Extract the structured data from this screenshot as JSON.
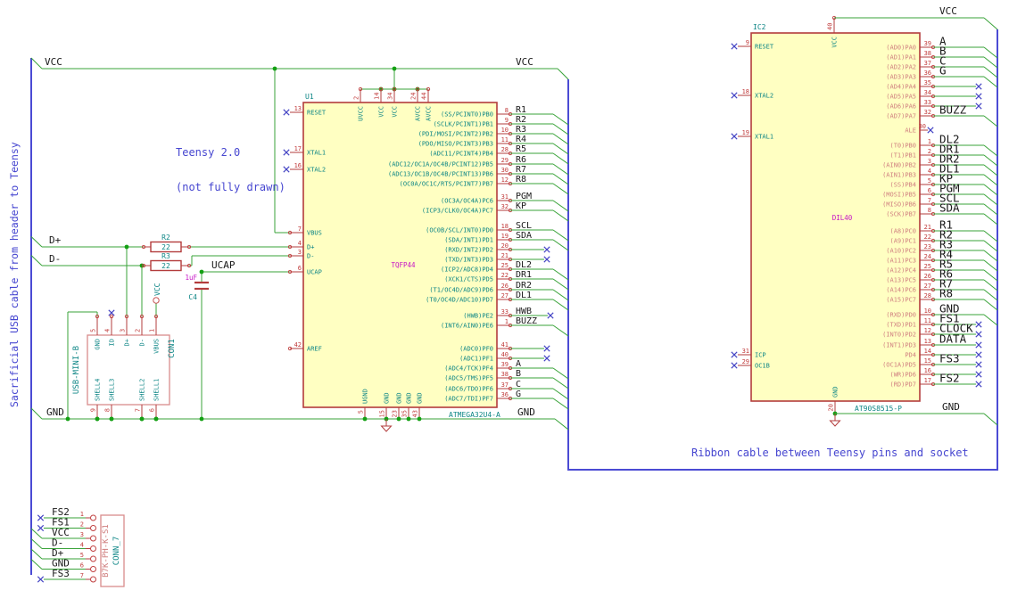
{
  "annotations": {
    "left_cable_note": "Sacrificial USB cable from header to Teensy",
    "teensy_note_line1": "Teensy 2.0",
    "teensy_note_line2": "(not fully drawn)",
    "ribbon_note": "Ribbon cable between Teensy pins and socket"
  },
  "power_labels": {
    "vcc_top_left": "VCC",
    "vcc_top_right": "VCC",
    "dplus": "D+",
    "dminus": "D-",
    "ucap": "UCAP",
    "gnd_left": "GND",
    "gnd_mid": "GND",
    "ic2_vcc": "VCC",
    "ic2_gnd": "GND",
    "usb_vcc": "VCC"
  },
  "u1": {
    "ref": "U1",
    "value": "ATMEGA32U4-A",
    "footprint": "TQFP44",
    "left_pins": [
      {
        "num": "13",
        "name": "RESET",
        "nc": true
      },
      {
        "num": "17",
        "name": "XTAL1",
        "nc": true
      },
      {
        "num": "16",
        "name": "XTAL2",
        "nc": true
      },
      {
        "num": "7",
        "name": "VBUS"
      },
      {
        "num": "4",
        "name": "D+"
      },
      {
        "num": "3",
        "name": "D-"
      },
      {
        "num": "6",
        "name": "UCAP"
      },
      {
        "num": "42",
        "name": "AREF"
      }
    ],
    "top_pins": [
      {
        "num": "2",
        "name": "UVCC"
      },
      {
        "num": "14",
        "name": "VCC"
      },
      {
        "num": "34",
        "name": "VCC"
      },
      {
        "num": "24",
        "name": "AVCC"
      },
      {
        "num": "44",
        "name": "AVCC"
      }
    ],
    "bottom_pins": [
      {
        "num": "5",
        "name": "UGND"
      },
      {
        "num": "15",
        "name": "GND"
      },
      {
        "num": "23",
        "name": "GND"
      },
      {
        "num": "35",
        "name": "GND"
      },
      {
        "num": "43",
        "name": "GND"
      }
    ],
    "right_pins": [
      {
        "num": "8",
        "name": "(SS/PCINT0)PB0",
        "net": "R1",
        "conn": "bus"
      },
      {
        "num": "9",
        "name": "(SCLK/PCINT1)PB1",
        "net": "R2",
        "conn": "bus"
      },
      {
        "num": "10",
        "name": "(PDI/MOSI/PCINT2)PB2",
        "net": "R3",
        "conn": "bus"
      },
      {
        "num": "11",
        "name": "(PDO/MISO/PCINT3)PB3",
        "net": "R4",
        "conn": "bus"
      },
      {
        "num": "28",
        "name": "(ADC11/PCINT4)PB4",
        "net": "R5",
        "conn": "bus"
      },
      {
        "num": "29",
        "name": "(ADC12/OC1A/OC4B/PCINT12)PB5",
        "net": "R6",
        "conn": "bus"
      },
      {
        "num": "30",
        "name": "(ADC13/OC1B/OC4B/PCINT13)PB6",
        "net": "R7",
        "conn": "bus"
      },
      {
        "num": "12",
        "name": "(OC0A/OC1C/RTS/PCINT7)PB7",
        "net": "R8",
        "conn": "bus"
      },
      {
        "num": "31",
        "name": "(OC3A/OC4A)PC6",
        "net": "PGM",
        "conn": "bus"
      },
      {
        "num": "32",
        "name": "(ICP3/CLK0/OC4A)PC7",
        "net": "KP",
        "conn": "bus"
      },
      {
        "num": "18",
        "name": "(OC0B/SCL/INT0)PD0",
        "net": "SCL",
        "conn": "bus"
      },
      {
        "num": "19",
        "name": "(SDA/INT1)PD1",
        "net": "SDA",
        "conn": "bus"
      },
      {
        "num": "20",
        "name": "(RXD/INT2)PD2",
        "net": "",
        "conn": "nc"
      },
      {
        "num": "21",
        "name": "(TXD/INT3)PD3",
        "net": "",
        "conn": "nc"
      },
      {
        "num": "25",
        "name": "(ICP2/ADC8)PD4",
        "net": "DL2",
        "conn": "bus"
      },
      {
        "num": "22",
        "name": "(XCK1/CTS)PD5",
        "net": "DR1",
        "conn": "bus"
      },
      {
        "num": "26",
        "name": "(T1/OC4D/ADC9)PD6",
        "net": "DR2",
        "conn": "bus"
      },
      {
        "num": "27",
        "name": "(T0/OC4D/ADC10)PD7",
        "net": "DL1",
        "conn": "bus"
      },
      {
        "num": "33",
        "name": "(HWB)PE2",
        "net": "HWB",
        "conn": "nc"
      },
      {
        "num": "1",
        "name": "(INT6/AIN0)PE6",
        "net": "BUZZ",
        "conn": "bus"
      },
      {
        "num": "41",
        "name": "(ADC0)PF0",
        "net": "",
        "conn": "nc"
      },
      {
        "num": "40",
        "name": "(ADC1)PF1",
        "net": "",
        "conn": "nc"
      },
      {
        "num": "39",
        "name": "(ADC4/TCK)PF4",
        "net": "A",
        "conn": "bus"
      },
      {
        "num": "38",
        "name": "(ADC5/TMS)PF5",
        "net": "B",
        "conn": "bus"
      },
      {
        "num": "37",
        "name": "(ADC6/TDO)PF6",
        "net": "C",
        "conn": "bus"
      },
      {
        "num": "36",
        "name": "(ADC7/TDI)PF7",
        "net": "G",
        "conn": "bus"
      }
    ]
  },
  "ic2": {
    "ref": "IC2",
    "value": "AT90S8515-P",
    "footprint": "DIL40",
    "left_pins": [
      {
        "num": "9",
        "name": "RESET",
        "nc": true
      },
      {
        "num": "18",
        "name": "XTAL2",
        "nc": true
      },
      {
        "num": "19",
        "name": "XTAL1",
        "nc": true
      },
      {
        "num": "31",
        "name": "ICP",
        "nc": true
      },
      {
        "num": "29",
        "name": "OC1B",
        "nc": true
      }
    ],
    "top_pins": [
      {
        "num": "40",
        "name": "VCC"
      }
    ],
    "bottom_pins": [
      {
        "num": "20",
        "name": "GND"
      }
    ],
    "right_pins": [
      {
        "num": "39",
        "name": "(AD0)PA0",
        "net": "A",
        "conn": "bus"
      },
      {
        "num": "38",
        "name": "(AD1)PA1",
        "net": "B",
        "conn": "bus"
      },
      {
        "num": "37",
        "name": "(AD2)PA2",
        "net": "C",
        "conn": "bus"
      },
      {
        "num": "36",
        "name": "(AD3)PA3",
        "net": "G",
        "conn": "bus"
      },
      {
        "num": "35",
        "name": "(AD4)PA4",
        "net": "",
        "conn": "nc"
      },
      {
        "num": "34",
        "name": "(AD5)PA5",
        "net": "",
        "conn": "nc"
      },
      {
        "num": "33",
        "name": "(AD6)PA6",
        "net": "",
        "conn": "nc"
      },
      {
        "num": "32",
        "name": "(AD7)PA7",
        "net": "BUZZ",
        "conn": "bus"
      },
      {
        "num": "30",
        "name": "ALE",
        "net": "",
        "conn": "stub"
      },
      {
        "num": "1",
        "name": "(T0)PB0",
        "net": "DL2",
        "conn": "bus"
      },
      {
        "num": "2",
        "name": "(T1)PB1",
        "net": "DR1",
        "conn": "bus"
      },
      {
        "num": "3",
        "name": "(AIN0)PB2",
        "net": "DR2",
        "conn": "bus"
      },
      {
        "num": "4",
        "name": "(AIN1)PB3",
        "net": "DL1",
        "conn": "bus"
      },
      {
        "num": "5",
        "name": "(SS)PB4",
        "net": "KP",
        "conn": "bus"
      },
      {
        "num": "6",
        "name": "(MOSI)PB5",
        "net": "PGM",
        "conn": "bus"
      },
      {
        "num": "7",
        "name": "(MISO)PB6",
        "net": "SCL",
        "conn": "bus"
      },
      {
        "num": "8",
        "name": "(SCK)PB7",
        "net": "SDA",
        "conn": "bus"
      },
      {
        "num": "21",
        "name": "(A8)PC0",
        "net": "R1",
        "conn": "bus"
      },
      {
        "num": "22",
        "name": "(A9)PC1",
        "net": "R2",
        "conn": "bus"
      },
      {
        "num": "23",
        "name": "(A10)PC2",
        "net": "R3",
        "conn": "bus"
      },
      {
        "num": "24",
        "name": "(A11)PC3",
        "net": "R4",
        "conn": "bus"
      },
      {
        "num": "25",
        "name": "(A12)PC4",
        "net": "R5",
        "conn": "bus"
      },
      {
        "num": "26",
        "name": "(A13)PC5",
        "net": "R6",
        "conn": "bus"
      },
      {
        "num": "27",
        "name": "(A14)PC6",
        "net": "R7",
        "conn": "bus"
      },
      {
        "num": "28",
        "name": "(A15)PC7",
        "net": "R8",
        "conn": "bus"
      },
      {
        "num": "10",
        "name": "(RXD)PD0",
        "net": "GND",
        "conn": "bus"
      },
      {
        "num": "11",
        "name": "(TXD)PD1",
        "net": "FS1",
        "conn": "nc"
      },
      {
        "num": "12",
        "name": "(INT0)PD2",
        "net": "CLOCK",
        "conn": "nc"
      },
      {
        "num": "13",
        "name": "(INT1)PD3",
        "net": "DATA",
        "conn": "nc"
      },
      {
        "num": "14",
        "name": "PD4",
        "net": "",
        "conn": "nc"
      },
      {
        "num": "15",
        "name": "(OC1A)PD5",
        "net": "FS3",
        "conn": "nc"
      },
      {
        "num": "16",
        "name": "(WR)PD6",
        "net": "",
        "conn": "nc"
      },
      {
        "num": "17",
        "name": "(RD)PD7",
        "net": "FS2",
        "conn": "nc"
      }
    ]
  },
  "usb": {
    "ref": "CON1",
    "value": "USB-MINI-B",
    "top_pins": [
      {
        "num": "5",
        "name": "GND"
      },
      {
        "num": "4",
        "name": "ID",
        "nc": true
      },
      {
        "num": "3",
        "name": "D+"
      },
      {
        "num": "2",
        "name": "D-"
      },
      {
        "num": "1",
        "name": "VBUS"
      }
    ],
    "bottom_pins": [
      {
        "num": "9",
        "name": "SHELL4"
      },
      {
        "num": "8",
        "name": "SHELL3"
      },
      {
        "num": "7",
        "name": "SHELL2"
      },
      {
        "num": "6",
        "name": "SHELL1"
      }
    ]
  },
  "r2": {
    "ref": "R2",
    "value": "22"
  },
  "r3": {
    "ref": "R3",
    "value": "22"
  },
  "c4": {
    "ref": "C4",
    "value": "1uF"
  },
  "conn7": {
    "ref": "CONN_7",
    "value": "B7K-PH-K-S1",
    "rows": [
      {
        "num": "1",
        "label": "FS2",
        "conn": "nc"
      },
      {
        "num": "2",
        "label": "FS1",
        "conn": "nc"
      },
      {
        "num": "3",
        "label": "VCC",
        "conn": "bus"
      },
      {
        "num": "4",
        "label": "D-",
        "conn": "bus"
      },
      {
        "num": "5",
        "label": "D+",
        "conn": "bus"
      },
      {
        "num": "6",
        "label": "GND",
        "conn": "bus"
      },
      {
        "num": "7",
        "label": "FS3",
        "conn": "nc"
      }
    ]
  }
}
